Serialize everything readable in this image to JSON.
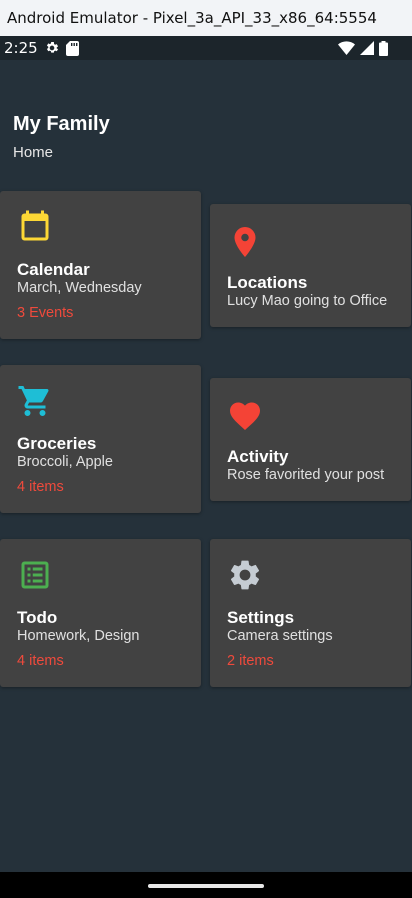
{
  "window": {
    "title": "Android Emulator - Pixel_3a_API_33_x86_64:5554"
  },
  "status_bar": {
    "time": "2:25",
    "icons": [
      "settings-gear-icon",
      "sd-card-icon",
      "wifi-icon",
      "cell-signal-icon",
      "battery-icon"
    ]
  },
  "header": {
    "title": "My Family",
    "subtitle": "Home"
  },
  "cards": {
    "calendar": {
      "title": "Calendar",
      "subtitle": "March, Wednesday",
      "count": "3 Events",
      "icon": "calendar-icon",
      "icon_color": "#fdd835"
    },
    "locations": {
      "title": "Locations",
      "subtitle": "Lucy Mao going to Office",
      "icon": "location-pin-icon",
      "icon_color": "#f44336"
    },
    "groceries": {
      "title": "Groceries",
      "subtitle": "Broccoli, Apple",
      "count": "4 items",
      "icon": "shopping-cart-icon",
      "icon_color": "#1ebed6"
    },
    "activity": {
      "title": "Activity",
      "subtitle": "Rose favorited your post",
      "icon": "heart-icon",
      "icon_color": "#f44336"
    },
    "todo": {
      "title": "Todo",
      "subtitle": "Homework, Design",
      "count": "4 items",
      "icon": "list-icon",
      "icon_color": "#4caf50"
    },
    "settings": {
      "title": "Settings",
      "subtitle": "Camera settings",
      "count": "2 items",
      "icon": "gear-icon",
      "icon_color": "#c5ccd3"
    }
  },
  "colors": {
    "background": "#25313a",
    "card": "#424242",
    "count_text": "#ef4a3c"
  }
}
